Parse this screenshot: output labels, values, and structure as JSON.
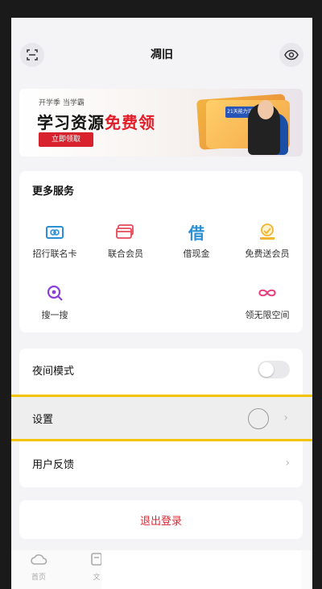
{
  "header": {
    "title": "凋旧",
    "left_icon": "scan-icon",
    "right_icon": "eye-icon"
  },
  "banner": {
    "top_text": "开学季 当学霸",
    "headline_black": "学习资源",
    "headline_red": "免费领",
    "button_label": "立即领取",
    "card_tag": "21天能力训练营"
  },
  "services": {
    "title": "更多服务",
    "items": [
      {
        "label": "招行联名卡",
        "icon": "bank-card-icon",
        "color": "#2b8fd6"
      },
      {
        "label": "联合会员",
        "icon": "member-card-icon",
        "color": "#e54a5a"
      },
      {
        "label": "借现金",
        "icon": "borrow-cash-icon",
        "color": "#2b8fd6",
        "glyph": "借"
      },
      {
        "label": "免费送会员",
        "icon": "gift-member-icon",
        "color": "#f2b530"
      },
      {
        "label": "搜一搜",
        "icon": "search-icon",
        "color": "#8b3fd9"
      },
      {
        "label": "领无限空间",
        "icon": "infinity-icon",
        "color": "#e83e7d"
      }
    ]
  },
  "settings": {
    "night_mode_label": "夜间模式",
    "settings_label": "设置",
    "feedback_label": "用户反馈"
  },
  "logout": {
    "label": "退出登录"
  },
  "tabbar": {
    "items": [
      {
        "label": "首页",
        "icon": "home-cloud-icon"
      },
      {
        "label": "文",
        "icon": "document-icon"
      }
    ]
  },
  "colors": {
    "accent_red": "#e0262f",
    "highlight": "#f5c400"
  }
}
